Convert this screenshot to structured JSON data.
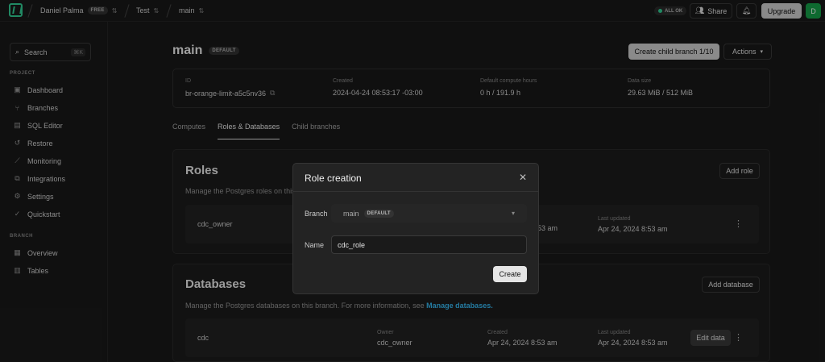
{
  "topbar": {
    "user": "Daniel Palma",
    "plan": "FREE",
    "project": "Test",
    "branch": "main",
    "status": "ALL OK",
    "share": "Share",
    "upgrade": "Upgrade",
    "avatar": "D"
  },
  "sidebar": {
    "search": "Search",
    "shortcut": "⌘K",
    "project_label": "PROJECT",
    "project_items": [
      "Dashboard",
      "Branches",
      "SQL Editor",
      "Restore",
      "Monitoring",
      "Integrations",
      "Settings",
      "Quickstart"
    ],
    "branch_label": "BRANCH",
    "branch_items": [
      "Overview",
      "Tables"
    ]
  },
  "header": {
    "title": "main",
    "badge": "DEFAULT",
    "create_child": "Create child branch 1/10",
    "actions": "Actions"
  },
  "info": {
    "id_label": "ID",
    "id_value": "br-orange-limit-a5c5nv36",
    "created_label": "Created",
    "created_value": "2024-04-24 08:53:17 -03:00",
    "compute_label": "Default compute hours",
    "compute_value": "0 h / 191.9 h",
    "size_label": "Data size",
    "size_value": "29.63 MiB / 512 MiB"
  },
  "tabs": [
    "Computes",
    "Roles & Databases",
    "Child branches"
  ],
  "roles": {
    "title": "Roles",
    "desc": "Manage the Postgres roles on this",
    "add": "Add role",
    "row": {
      "name": "cdc_owner",
      "created_frag": "53 am",
      "updated_label": "Last updated",
      "updated": "Apr 24, 2024 8:53 am"
    }
  },
  "databases": {
    "title": "Databases",
    "desc": "Manage the Postgres databases on this branch. For more information, see ",
    "link": "Manage databases.",
    "add": "Add database",
    "row": {
      "name": "cdc",
      "owner_label": "Owner",
      "owner": "cdc_owner",
      "created_label": "Created",
      "created": "Apr 24, 2024 8:53 am",
      "updated_label": "Last updated",
      "updated": "Apr 24, 2024 8:53 am",
      "edit": "Edit data"
    }
  },
  "modal": {
    "title": "Role creation",
    "branch_label": "Branch",
    "branch_value": "main",
    "branch_badge": "DEFAULT",
    "name_label": "Name",
    "name_value": "cdc_role",
    "create": "Create"
  },
  "colors": {
    "accent": "#34d399",
    "link": "#38bdf8",
    "avatar": "#16a34a"
  }
}
